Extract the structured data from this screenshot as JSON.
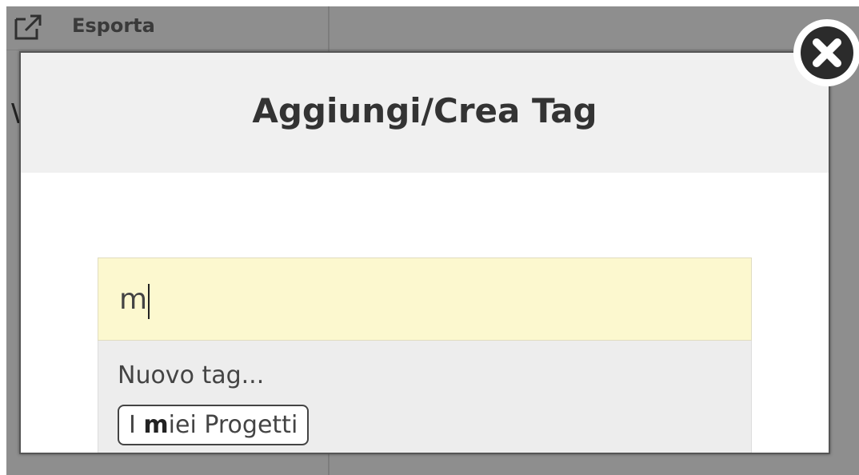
{
  "background": {
    "toolbar": {
      "export_label": "Esporta",
      "export_icon": "export-icon"
    },
    "partial_glyph": "\\"
  },
  "modal": {
    "title": "Aggiungi/Crea Tag",
    "close_icon": "close-icon",
    "tag_input": {
      "value": "m",
      "highlight_color": "#fcf8cf"
    },
    "dropdown": {
      "new_tag_label": "Nuovo tag...",
      "suggestion": {
        "prefix": "I ",
        "match": "m",
        "suffix": "iei Progetti"
      }
    }
  }
}
